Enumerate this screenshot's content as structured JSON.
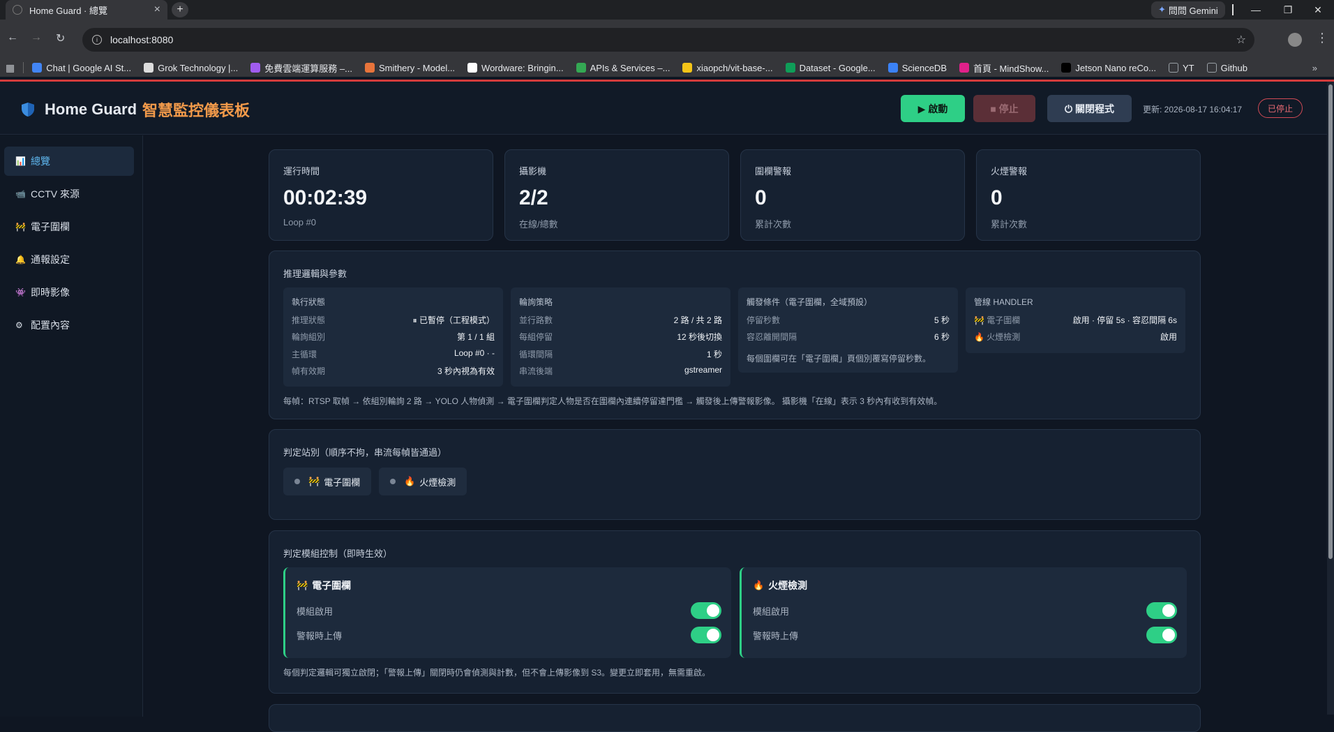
{
  "browser": {
    "tab_title": "Home Guard · 總覽",
    "gemini_label": "問問 Gemini",
    "url": "localhost:8080",
    "bookmarks": [
      {
        "label": "Chat | Google AI St...",
        "color": "#4285f4"
      },
      {
        "label": "Grok Technology |...",
        "color": "#dddddd"
      },
      {
        "label": "免費雲端運算服務 –...",
        "color": "#a05cf0"
      },
      {
        "label": "Smithery - Model...",
        "color": "#e8743b"
      },
      {
        "label": "Wordware: Bringin...",
        "color": "#ffffff"
      },
      {
        "label": "APIs & Services –...",
        "color": "#34a853"
      },
      {
        "label": "xiaopch/vit-base-...",
        "color": "#f5c518"
      },
      {
        "label": "Dataset - Google...",
        "color": "#0f9d58"
      },
      {
        "label": "ScienceDB",
        "color": "#3b82f6"
      },
      {
        "label": "首頁 - MindShow...",
        "color": "#e0218a"
      },
      {
        "label": "Jetson Nano reCo...",
        "color": "#000000"
      },
      {
        "label": "YT",
        "color": "#9aa0a6"
      },
      {
        "label": "Github",
        "color": "#9aa0a6"
      }
    ]
  },
  "header": {
    "brand": "Home Guard",
    "brand_accent": "智慧監控儀表板",
    "start_label": "▶ 啟動",
    "stop_label": "■ 停止",
    "quit_label": "⏻ 關閉程式",
    "updated": "更新: 2026-08-17 16:04:17",
    "status": "已停止"
  },
  "sidebar": {
    "items": [
      {
        "icon": "📊",
        "label": "總覽"
      },
      {
        "icon": "📹",
        "label": "CCTV 來源"
      },
      {
        "icon": "🚧",
        "label": "電子圍欄"
      },
      {
        "icon": "🔔",
        "label": "通報設定"
      },
      {
        "icon": "👾",
        "label": "即時影像"
      },
      {
        "icon": "⚙",
        "label": "配置內容"
      }
    ]
  },
  "stats": [
    {
      "label": "運行時間",
      "value": "00:02:39",
      "sub": "Loop #0"
    },
    {
      "label": "攝影機",
      "value": "2/2",
      "sub": "在線/總數"
    },
    {
      "label": "圍欄警報",
      "value": "0",
      "sub": "累計次數"
    },
    {
      "label": "火煙警報",
      "value": "0",
      "sub": "累計次數"
    }
  ],
  "logic": {
    "title": "推理邏輯與參數",
    "exec": {
      "title": "執行狀態",
      "rows": [
        {
          "k": "推理狀態",
          "v": "⏸ 已暫停（工程模式）"
        },
        {
          "k": "輪詢組別",
          "v": "第 1 / 1 組"
        },
        {
          "k": "主循環",
          "v": "Loop #0 · -"
        },
        {
          "k": "幀有效期",
          "v": "3 秒內視為有效"
        }
      ]
    },
    "polling": {
      "title": "輪詢策略",
      "rows": [
        {
          "k": "並行路數",
          "v": "2 路 / 共 2 路"
        },
        {
          "k": "每組停留",
          "v": "12 秒後切換"
        },
        {
          "k": "循環間隔",
          "v": "1 秒"
        },
        {
          "k": "串流後端",
          "v": "gstreamer"
        }
      ]
    },
    "trigger": {
      "title": "觸發條件（電子圍欄，全域預設）",
      "rows": [
        {
          "k": "停留秒數",
          "v": "5 秒"
        },
        {
          "k": "容忍離開間隔",
          "v": "6 秒"
        }
      ],
      "note": "每個圍欄可在「電子圍欄」頁個別覆寫停留秒數。"
    },
    "handler": {
      "title": "管線 HANDLER",
      "rows": [
        {
          "icon": "🚧",
          "k": "電子圍欄",
          "v": "啟用 · 停留 5s · 容忍間隔 6s"
        },
        {
          "icon": "🔥",
          "k": "火煙檢測",
          "v": "啟用"
        }
      ]
    },
    "flow": "每幀：RTSP 取幀 → 依組別輪詢 2 路 → YOLO 人物偵測 → 電子圍欄判定人物是否在圍欄內連續停留達門檻 → 觸發後上傳警報影像。 攝影機「在線」表示 3 秒內有收到有效幀。"
  },
  "stations": {
    "title": "判定站別（順序不拘，串流每幀皆通過）",
    "chips": [
      {
        "icon": "🚧",
        "label": "電子圍欄"
      },
      {
        "icon": "🔥",
        "label": "火煙檢測"
      }
    ]
  },
  "modules": {
    "title": "判定模組控制（即時生效）",
    "items": [
      {
        "icon": "🚧",
        "name": "電子圍欄",
        "enable_label": "模組啟用",
        "upload_label": "警報時上傳",
        "enabled": true,
        "upload": true
      },
      {
        "icon": "🔥",
        "name": "火煙檢測",
        "enable_label": "模組啟用",
        "upload_label": "警報時上傳",
        "enabled": true,
        "upload": true
      }
    ],
    "note": "每個判定邏輯可獨立啟閉；「警報上傳」關閉時仍會偵測與計數，但不會上傳影像到 S3。變更立即套用，無需重啟。"
  },
  "colors": {
    "accent_green": "#2ecf86",
    "accent_orange": "#f29a4a",
    "danger": "#d04a55",
    "active_nav": "#5fb8f0"
  }
}
